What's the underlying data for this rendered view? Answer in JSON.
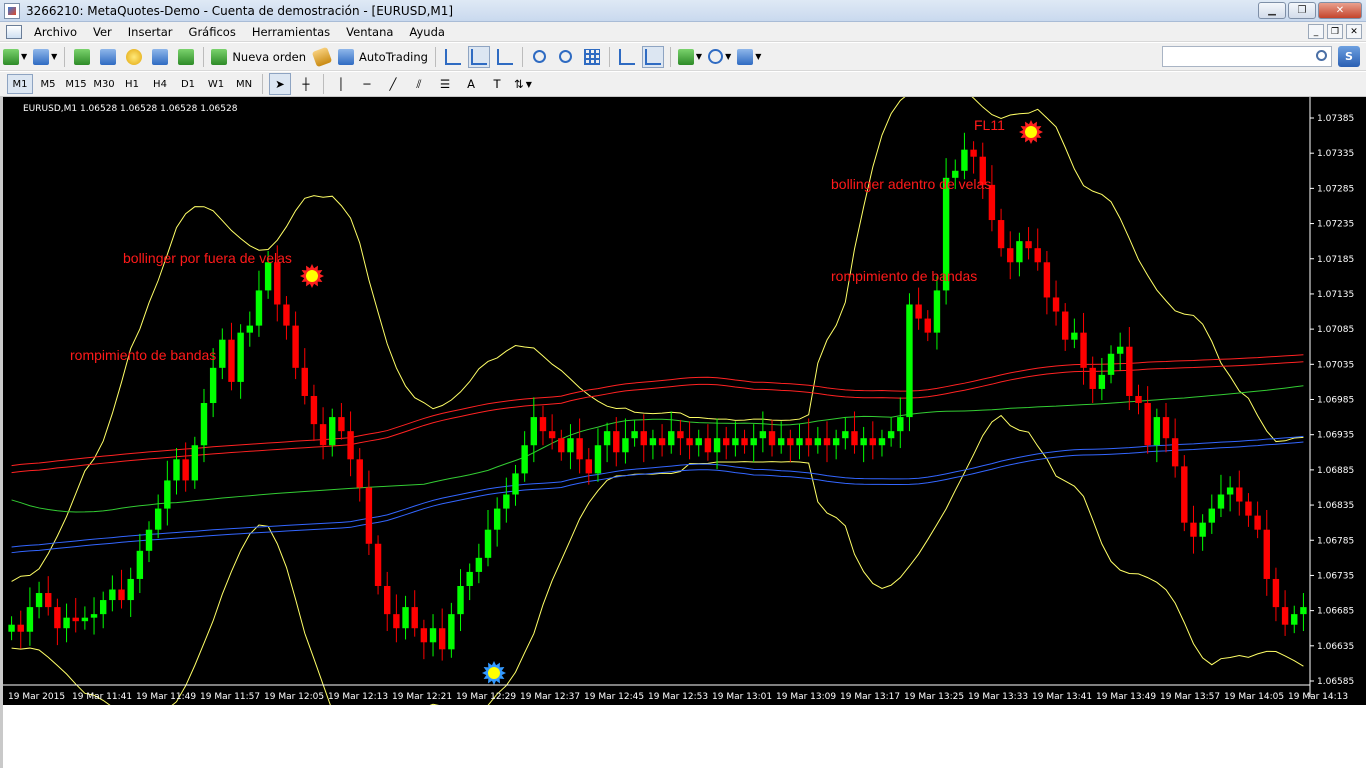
{
  "window": {
    "title": "3266210: MetaQuotes-Demo - Cuenta de demostración - [EURUSD,M1]"
  },
  "menu": [
    "Archivo",
    "Ver",
    "Insertar",
    "Gráficos",
    "Herramientas",
    "Ventana",
    "Ayuda"
  ],
  "toolbar": {
    "new_order": "Nueva orden",
    "autotrading": "AutoTrading"
  },
  "timeframes": [
    "M1",
    "M5",
    "M15",
    "M30",
    "H1",
    "H4",
    "D1",
    "W1",
    "MN"
  ],
  "timeframe_selected": "M1",
  "colors": {
    "bull": "#00ff00",
    "bear": "#ff0000",
    "bollinger": "#ffff66",
    "ma_green": "#33cc33",
    "ma_red": "#ff2222",
    "ma_blue": "#3366ff",
    "annotation": "#ff1a1a"
  },
  "chart_data": {
    "type": "candlestick",
    "symbol_info": "EURUSD,M1  1.06528 1.06528 1.06528 1.06528",
    "ylim": [
      1.06585,
      1.07385
    ],
    "y_ticks": [
      "1.07385",
      "1.07335",
      "1.07285",
      "1.07235",
      "1.07185",
      "1.07135",
      "1.07085",
      "1.07035",
      "1.06985",
      "1.06935",
      "1.06885",
      "1.06835",
      "1.06785",
      "1.06735",
      "1.06685",
      "1.06635",
      "1.06585"
    ],
    "x_ticks": [
      "19 Mar 2015",
      "19 Mar 11:41",
      "19 Mar 11:49",
      "19 Mar 11:57",
      "19 Mar 12:05",
      "19 Mar 12:13",
      "19 Mar 12:21",
      "19 Mar 12:29",
      "19 Mar 12:37",
      "19 Mar 12:45",
      "19 Mar 12:53",
      "19 Mar 13:01",
      "19 Mar 13:09",
      "19 Mar 13:17",
      "19 Mar 13:25",
      "19 Mar 13:33",
      "19 Mar 13:41",
      "19 Mar 13:49",
      "19 Mar 13:57",
      "19 Mar 14:05",
      "19 Mar 14:13"
    ],
    "close": [
      1.06665,
      1.06655,
      1.0669,
      1.0671,
      1.0669,
      1.0666,
      1.06675,
      1.0667,
      1.06675,
      1.0668,
      1.067,
      1.06715,
      1.067,
      1.0673,
      1.0677,
      1.068,
      1.0683,
      1.0687,
      1.069,
      1.0687,
      1.0692,
      1.0698,
      1.0703,
      1.0707,
      1.0701,
      1.0708,
      1.0709,
      1.0714,
      1.0718,
      1.0712,
      1.0709,
      1.0703,
      1.0699,
      1.0695,
      1.0692,
      1.0696,
      1.0694,
      1.069,
      1.0686,
      1.0678,
      1.0672,
      1.0668,
      1.0666,
      1.0669,
      1.0666,
      1.0664,
      1.0666,
      1.0663,
      1.0668,
      1.0672,
      1.0674,
      1.0676,
      1.068,
      1.0683,
      1.0685,
      1.0688,
      1.0692,
      1.0696,
      1.0694,
      1.0693,
      1.0691,
      1.0693,
      1.069,
      1.0688,
      1.0692,
      1.0694,
      1.0691,
      1.0693,
      1.0694,
      1.0692,
      1.0693,
      1.0692,
      1.0694,
      1.0693,
      1.0692,
      1.0693,
      1.0691,
      1.0693,
      1.0692,
      1.0693,
      1.0692,
      1.0693,
      1.0694,
      1.0692,
      1.0693,
      1.0692,
      1.0693,
      1.0692,
      1.0693,
      1.0692,
      1.0693,
      1.0694,
      1.0692,
      1.0693,
      1.0692,
      1.0693,
      1.0694,
      1.0696,
      1.0712,
      1.071,
      1.0708,
      1.0714,
      1.073,
      1.0731,
      1.0734,
      1.0733,
      1.0729,
      1.0724,
      1.072,
      1.0718,
      1.0721,
      1.072,
      1.0718,
      1.0713,
      1.0711,
      1.0707,
      1.0708,
      1.0703,
      1.07,
      1.0702,
      1.0705,
      1.0706,
      1.0699,
      1.0698,
      1.0692,
      1.0696,
      1.0693,
      1.0689,
      1.0681,
      1.0679,
      1.0681,
      1.0683,
      1.0685,
      1.0686,
      1.0684,
      1.0682,
      1.068,
      1.0673,
      1.0669,
      1.06665,
      1.0668,
      1.0669
    ],
    "bands": {
      "upper_ref": "bollinger",
      "ma_green": "green",
      "ma_red": "red",
      "ma_blue": "blue"
    },
    "annotations": [
      {
        "text": "bollinger por fuera de velas"
      },
      {
        "text": "rompimiento de bandas"
      },
      {
        "text": "FL11"
      },
      {
        "text": "bollinger adentro de velas"
      },
      {
        "text": "rompimiento de bandas"
      }
    ]
  }
}
